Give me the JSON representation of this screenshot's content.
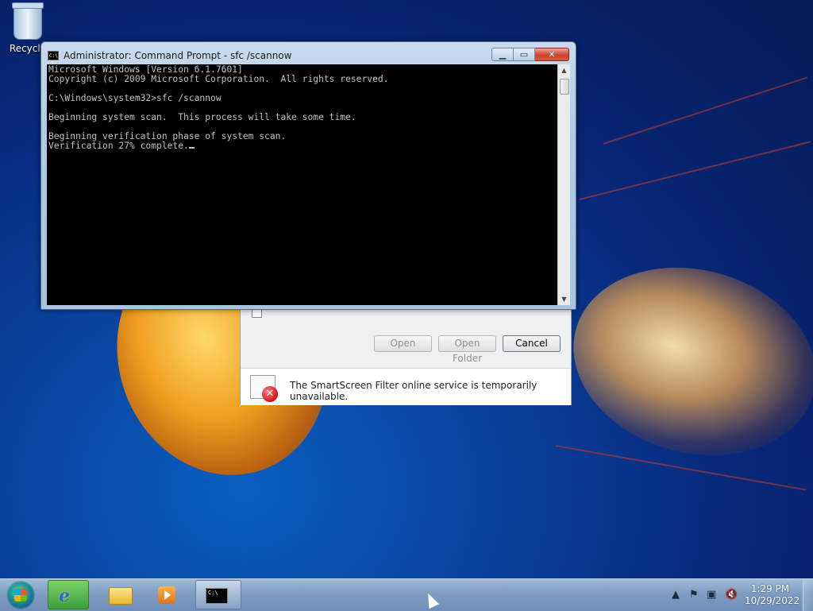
{
  "desktop": {
    "recycle_bin_label": "Recycle"
  },
  "cmd_window": {
    "title": "Administrator: Command Prompt - sfc  /scannow",
    "icon_text": "C:\\",
    "lines": [
      "Microsoft Windows [Version 6.1.7601]",
      "Copyright (c) 2009 Microsoft Corporation.  All rights reserved.",
      "",
      "C:\\Windows\\system32>sfc /scannow",
      "",
      "Beginning system scan.  This process will take some time.",
      "",
      "Beginning verification phase of system scan.",
      "Verification 27% complete."
    ],
    "verification_progress_percent": 27
  },
  "download_dialog": {
    "open_label": "Open",
    "open_folder_label": "Open Folder",
    "cancel_label": "Cancel",
    "smartscreen_message": "The SmartScreen Filter online service is temporarily unavailable."
  },
  "taskbar": {
    "items": [
      {
        "icon": "internet-explorer-icon"
      },
      {
        "icon": "folder-icon"
      },
      {
        "icon": "media-player-icon"
      },
      {
        "icon": "command-prompt-icon"
      }
    ],
    "clock_time": "1:29 PM",
    "clock_date": "10/29/2022",
    "tray_icons": [
      "show-hidden-icons-icon",
      "action-center-flag-icon",
      "network-icon",
      "volume-muted-icon"
    ]
  },
  "colors": {
    "console_bg": "#000000",
    "console_text": "#c0c0c0",
    "close_button": "#c9452c"
  }
}
